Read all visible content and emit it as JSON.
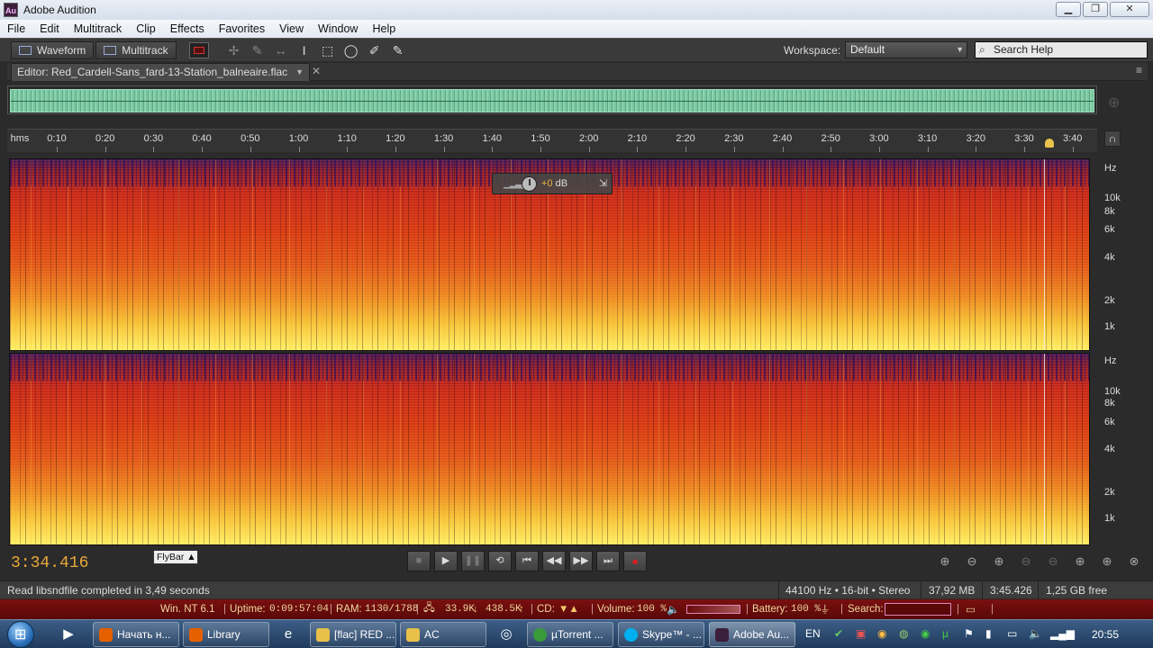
{
  "window": {
    "title": "Adobe Audition",
    "icon": "Au",
    "btn_min": "▁",
    "btn_max": "❐",
    "btn_close": "✕"
  },
  "menu": [
    "File",
    "Edit",
    "Multitrack",
    "Clip",
    "Effects",
    "Favorites",
    "View",
    "Window",
    "Help"
  ],
  "toolbar": {
    "waveform": "Waveform",
    "multitrack": "Multitrack",
    "workspace_label": "Workspace:",
    "workspace_value": "Default",
    "search_placeholder": "Search Help"
  },
  "editor": {
    "tab_label": "Editor: Red_Cardell-Sans_fard-13-Station_balneaire.flac",
    "ruler_unit": "hms",
    "ruler_ticks": [
      "0:10",
      "0:20",
      "0:30",
      "0:40",
      "0:50",
      "1:00",
      "1:10",
      "1:20",
      "1:30",
      "1:40",
      "1:50",
      "2:00",
      "2:10",
      "2:20",
      "2:30",
      "2:40",
      "2:50",
      "3:00",
      "3:10",
      "3:20",
      "3:30",
      "3:40"
    ],
    "hz_unit": "Hz",
    "hz_labels": [
      "10k",
      "8k",
      "6k",
      "4k",
      "2k",
      "1k"
    ],
    "hud_gain": "+0",
    "hud_unit": "dB"
  },
  "transport": {
    "current_time": "3:34.416",
    "flybar": "FlyBar"
  },
  "status": {
    "message": "Read libsndfile completed in 3,49 seconds",
    "sample_rate": "44100 Hz • 16-bit • Stereo",
    "file_size": "37,92 MB",
    "duration": "3:45.426",
    "disk_free": "1,25 GB free"
  },
  "sysinfo": {
    "os": "Win. NT 6.1",
    "uptime_label": "Uptime:",
    "uptime": "0:09:57:04",
    "ram_label": "RAM:",
    "ram": "1130/1788",
    "down": "33.9K",
    "up": "438.5K",
    "cd_label": "CD:",
    "volume_label": "Volume:",
    "volume": "100 %",
    "battery_label": "Battery:",
    "battery": "100 %",
    "search_label": "Search:"
  },
  "taskbar": {
    "items": [
      "Начать н...",
      "Library",
      "[flac] RED ...",
      "AC",
      "µTorrent ...",
      "Skype™ - ...",
      "Adobe Au..."
    ],
    "lang": "EN",
    "clock": "20:55"
  },
  "colors": {
    "accent_time": "#e9a93a",
    "sysbar": "#6a0c0c",
    "waveform": "#79c6a0"
  }
}
